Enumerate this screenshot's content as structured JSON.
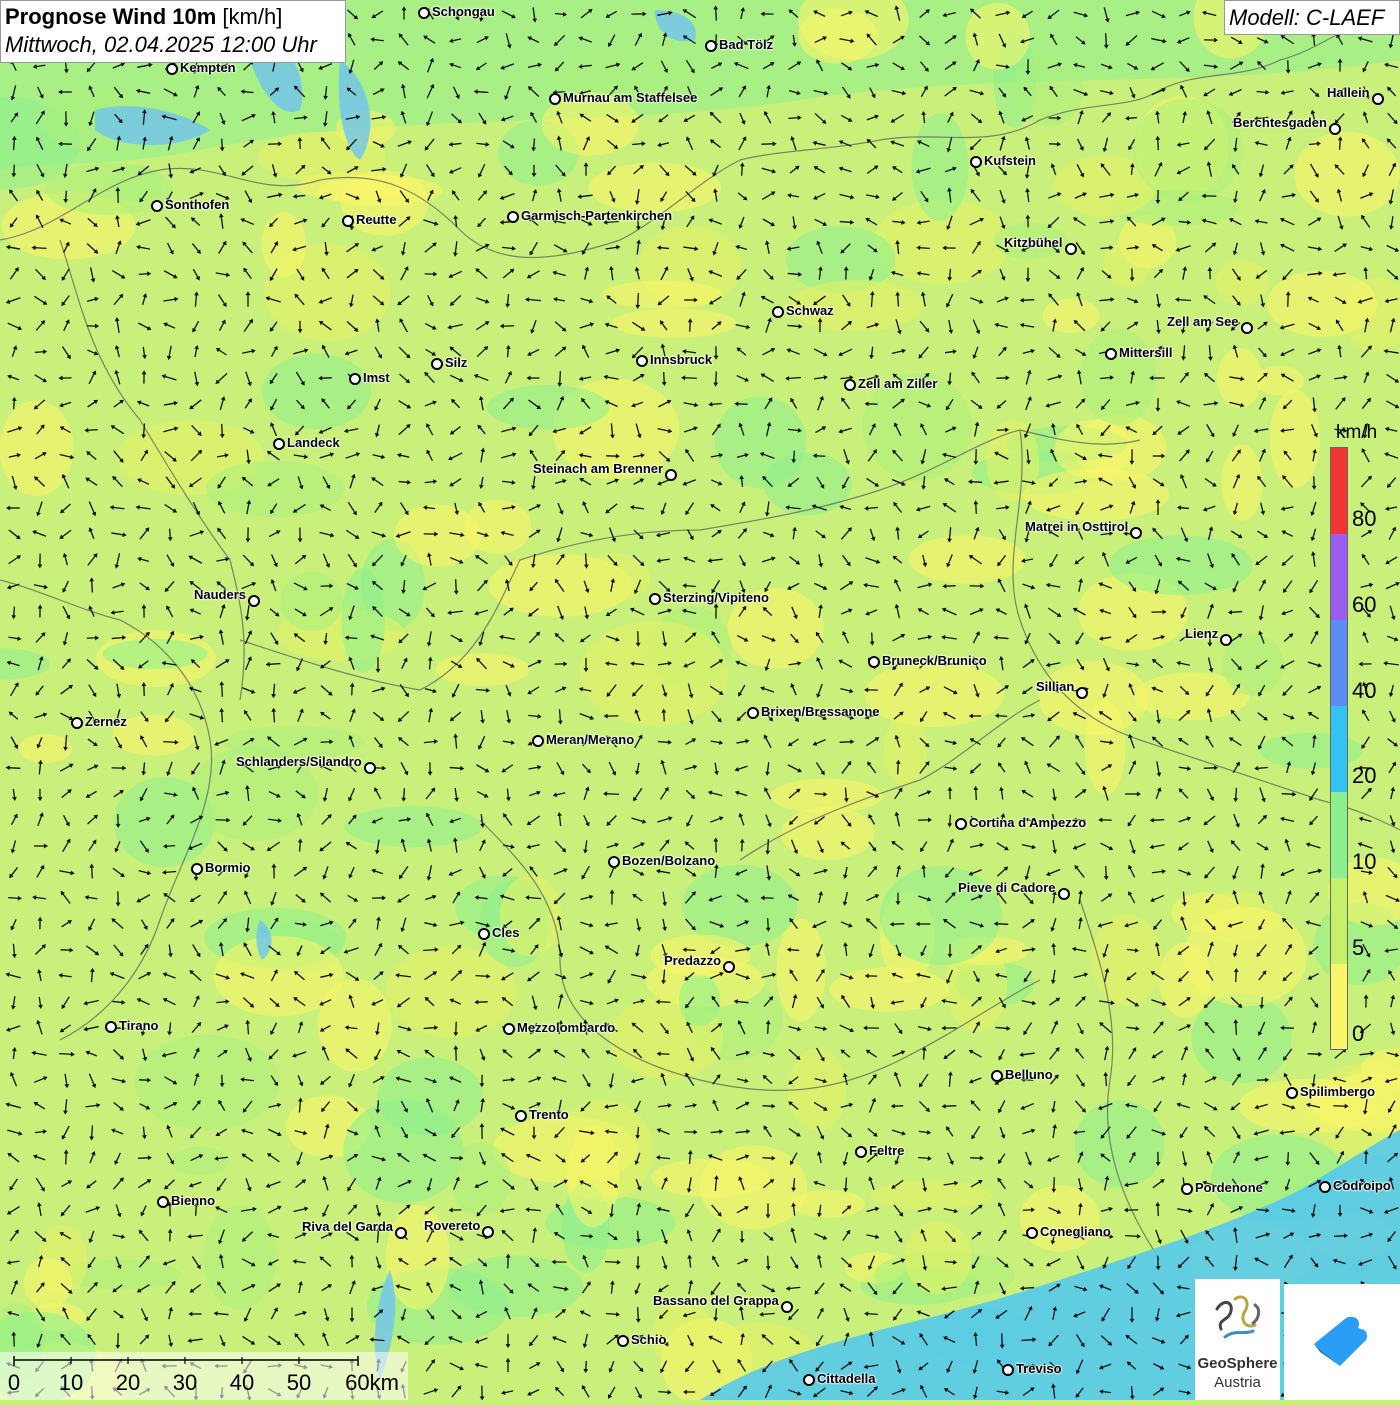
{
  "header": {
    "title_bold": "Prognose Wind 10m",
    "title_unit": "[km/h]",
    "subtitle": "Mittwoch, 02.04.2025 12:00 Uhr",
    "model": "Modell: C-LAEF"
  },
  "legend": {
    "unit": "km/h",
    "classes": [
      {
        "label": "0",
        "color": "#fbf56a"
      },
      {
        "label": "5",
        "color": "#c6f06a"
      },
      {
        "label": "10",
        "color": "#8df08e"
      },
      {
        "label": "20",
        "color": "#34c2f2"
      },
      {
        "label": "40",
        "color": "#5a8cf2"
      },
      {
        "label": "60",
        "color": "#9b5ef0"
      },
      {
        "label": "80",
        "color": "#f23434"
      }
    ]
  },
  "scale": {
    "labels": [
      "0",
      "10",
      "20",
      "30",
      "40",
      "50",
      "60km"
    ]
  },
  "cities": [
    {
      "name": "Schongau",
      "side": "r"
    },
    {
      "name": "Bad Tölz",
      "side": "r"
    },
    {
      "name": "Kempten",
      "side": "r"
    },
    {
      "name": "Murnau am Staffelsee",
      "side": "r"
    },
    {
      "name": "Hallein",
      "side": "l"
    },
    {
      "name": "Berchtesgaden",
      "side": "l"
    },
    {
      "name": "Kufstein",
      "side": "r"
    },
    {
      "name": "Sonthofen",
      "side": "r"
    },
    {
      "name": "Reutte",
      "side": "r"
    },
    {
      "name": "Garmisch-Partenkirchen",
      "side": "r"
    },
    {
      "name": "Kitzbühel",
      "side": "l"
    },
    {
      "name": "Schwaz",
      "side": "r"
    },
    {
      "name": "Zell am See",
      "side": "l"
    },
    {
      "name": "Mittersill",
      "side": "r"
    },
    {
      "name": "Silz",
      "side": "r"
    },
    {
      "name": "Innsbruck",
      "side": "r"
    },
    {
      "name": "Imst",
      "side": "r"
    },
    {
      "name": "Zell am Ziller",
      "side": "r"
    },
    {
      "name": "Landeck",
      "side": "r"
    },
    {
      "name": "Steinach am Brenner",
      "side": "l"
    },
    {
      "name": "Matrei in Osttirol",
      "side": "l"
    },
    {
      "name": "Nauders",
      "side": "l"
    },
    {
      "name": "Sterzing/Vipiteno",
      "side": "r"
    },
    {
      "name": "Lienz",
      "side": "l"
    },
    {
      "name": "Bruneck/Brunico",
      "side": "r"
    },
    {
      "name": "Sillian",
      "side": "l"
    },
    {
      "name": "Zernez",
      "side": "r"
    },
    {
      "name": "Brixen/Bressanone",
      "side": "r"
    },
    {
      "name": "Meran/Merano",
      "side": "r"
    },
    {
      "name": "Schlanders/Silandro",
      "side": "l"
    },
    {
      "name": "Cortina d'Ampezzo",
      "side": "r"
    },
    {
      "name": "Bozen/Bolzano",
      "side": "r"
    },
    {
      "name": "Bormio",
      "side": "r"
    },
    {
      "name": "Pieve di Cadore",
      "side": "l"
    },
    {
      "name": "Cles",
      "side": "r"
    },
    {
      "name": "Predazzo",
      "side": "l"
    },
    {
      "name": "Tirano",
      "side": "r"
    },
    {
      "name": "Mezzolombardo",
      "side": "r"
    },
    {
      "name": "Belluno",
      "side": "r"
    },
    {
      "name": "Spilimbergo",
      "side": "r"
    },
    {
      "name": "Trento",
      "side": "r"
    },
    {
      "name": "Feltre",
      "side": "r"
    },
    {
      "name": "Pordenone",
      "side": "r"
    },
    {
      "name": "Codroipo",
      "side": "r"
    },
    {
      "name": "Bienno",
      "side": "r"
    },
    {
      "name": "Riva del Garda",
      "side": "l"
    },
    {
      "name": "Rovereto",
      "side": "l"
    },
    {
      "name": "Conegliano",
      "side": "r"
    },
    {
      "name": "Bassano del Grappa",
      "side": "l"
    },
    {
      "name": "Schio",
      "side": "r"
    },
    {
      "name": "Treviso",
      "side": "r"
    },
    {
      "name": "Cittadella",
      "side": "r"
    }
  ],
  "logos": {
    "geosphere_line1": "GeoSphere",
    "geosphere_line2": "Austria"
  }
}
